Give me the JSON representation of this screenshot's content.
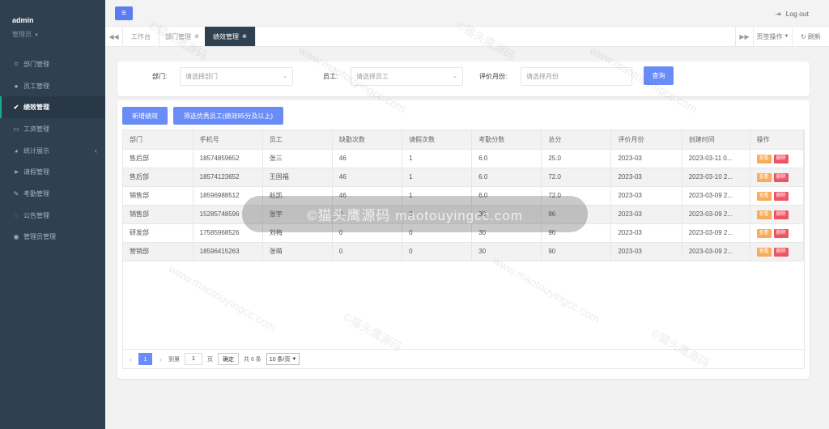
{
  "sidebar": {
    "user_name": "admin",
    "user_role": "管理员",
    "items": [
      {
        "label": "部门管理",
        "icon": "bookmark-icon"
      },
      {
        "label": "员工管理",
        "icon": "user-icon"
      },
      {
        "label": "绩效管理",
        "icon": "check-circle-icon"
      },
      {
        "label": "工资管理",
        "icon": "money-icon"
      },
      {
        "label": "统计展示",
        "icon": "pie-chart-icon"
      },
      {
        "label": "请假管理",
        "icon": "paper-plane-icon"
      },
      {
        "label": "考勤管理",
        "icon": "edit-icon"
      },
      {
        "label": "公告管理",
        "icon": "comment-icon"
      },
      {
        "label": "管理员管理",
        "icon": "user-circle-icon"
      }
    ]
  },
  "topbar": {
    "logout_label": "Log out"
  },
  "tabs": {
    "items": [
      {
        "label": "工作台"
      },
      {
        "label": "部门管理"
      },
      {
        "label": "绩效管理"
      }
    ],
    "ops_label": "页签操作",
    "refresh_label": "刷新"
  },
  "search": {
    "dept_label": "部门:",
    "dept_placeholder": "请选择部门",
    "emp_label": "员工:",
    "emp_placeholder": "请选择员工",
    "month_label": "评价月份:",
    "month_placeholder": "请选择月份",
    "query_label": "查询"
  },
  "toolbar": {
    "add_label": "新增绩效",
    "filter_label": "筛选优秀员工(绩效85分及以上)"
  },
  "table": {
    "headers": [
      "部门",
      "手机号",
      "员工",
      "缺勤次数",
      "请假次数",
      "考勤分数",
      "总分",
      "评价月份",
      "创建时间",
      "操作"
    ],
    "rows": [
      [
        "售后部",
        "18574859652",
        "张三",
        "46",
        "1",
        "6.0",
        "25.0",
        "2023-03",
        "2023-03-11 0..."
      ],
      [
        "售后部",
        "18574123652",
        "王国福",
        "46",
        "1",
        "6.0",
        "72.0",
        "2023-03",
        "2023-03-10 2..."
      ],
      [
        "销售部",
        "18596988512",
        "赵凯",
        "46",
        "1",
        "6.0",
        "72.0",
        "2023-03",
        "2023-03-09 2..."
      ],
      [
        "销售部",
        "15285748596",
        "张宇",
        "0",
        "0",
        "30",
        "96",
        "2023-03",
        "2023-03-09 2..."
      ],
      [
        "研发部",
        "17585968526",
        "刘梅",
        "0",
        "0",
        "30",
        "96",
        "2023-03",
        "2023-03-09 2..."
      ],
      [
        "营销部",
        "18596415263",
        "张萌",
        "0",
        "0",
        "30",
        "90",
        "2023-03",
        "2023-03-09 2..."
      ]
    ],
    "view_label": "查看",
    "delete_label": "删除"
  },
  "pager": {
    "current_page": "1",
    "goto_label": "到第",
    "goto_value": "1",
    "page_unit": "页",
    "confirm_label": "确定",
    "total_label": "共 6 条",
    "page_size": "10 条/页"
  },
  "watermark": {
    "pill_text": "©猫头鹰源码 maotouyingcc.com",
    "line1": "©猫头鹰源码",
    "line2": "www.maotouyingcc.com"
  },
  "colors": {
    "sidebar_bg": "#2f4050",
    "primary_button": "#6a8cf7",
    "view_button": "#f8ac59",
    "delete_button": "#ed5565"
  }
}
